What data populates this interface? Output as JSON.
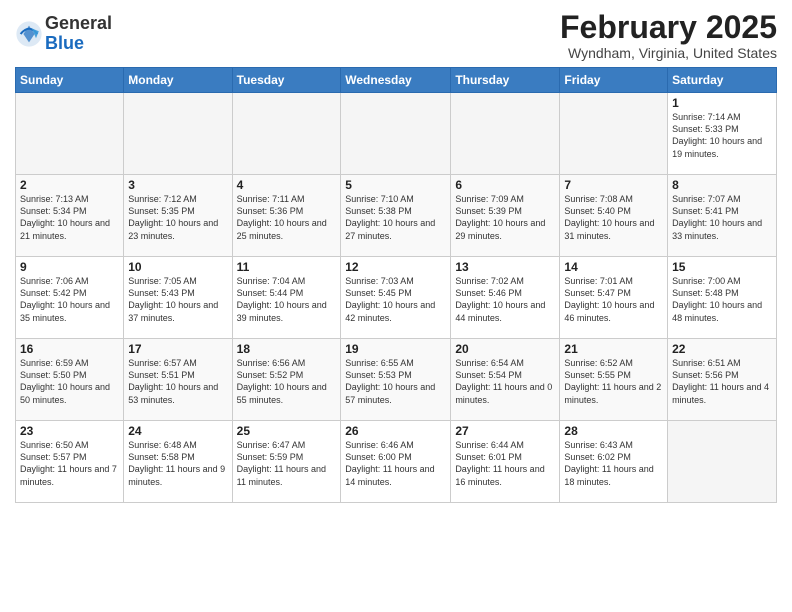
{
  "header": {
    "logo_general": "General",
    "logo_blue": "Blue",
    "title": "February 2025",
    "location": "Wyndham, Virginia, United States"
  },
  "days_of_week": [
    "Sunday",
    "Monday",
    "Tuesday",
    "Wednesday",
    "Thursday",
    "Friday",
    "Saturday"
  ],
  "weeks": [
    [
      {
        "day": "",
        "empty": true
      },
      {
        "day": "",
        "empty": true
      },
      {
        "day": "",
        "empty": true
      },
      {
        "day": "",
        "empty": true
      },
      {
        "day": "",
        "empty": true
      },
      {
        "day": "",
        "empty": true
      },
      {
        "day": "1",
        "sunrise": "7:14 AM",
        "sunset": "5:33 PM",
        "daylight": "10 hours and 19 minutes."
      }
    ],
    [
      {
        "day": "2",
        "sunrise": "7:13 AM",
        "sunset": "5:34 PM",
        "daylight": "10 hours and 21 minutes."
      },
      {
        "day": "3",
        "sunrise": "7:12 AM",
        "sunset": "5:35 PM",
        "daylight": "10 hours and 23 minutes."
      },
      {
        "day": "4",
        "sunrise": "7:11 AM",
        "sunset": "5:36 PM",
        "daylight": "10 hours and 25 minutes."
      },
      {
        "day": "5",
        "sunrise": "7:10 AM",
        "sunset": "5:38 PM",
        "daylight": "10 hours and 27 minutes."
      },
      {
        "day": "6",
        "sunrise": "7:09 AM",
        "sunset": "5:39 PM",
        "daylight": "10 hours and 29 minutes."
      },
      {
        "day": "7",
        "sunrise": "7:08 AM",
        "sunset": "5:40 PM",
        "daylight": "10 hours and 31 minutes."
      },
      {
        "day": "8",
        "sunrise": "7:07 AM",
        "sunset": "5:41 PM",
        "daylight": "10 hours and 33 minutes."
      }
    ],
    [
      {
        "day": "9",
        "sunrise": "7:06 AM",
        "sunset": "5:42 PM",
        "daylight": "10 hours and 35 minutes."
      },
      {
        "day": "10",
        "sunrise": "7:05 AM",
        "sunset": "5:43 PM",
        "daylight": "10 hours and 37 minutes."
      },
      {
        "day": "11",
        "sunrise": "7:04 AM",
        "sunset": "5:44 PM",
        "daylight": "10 hours and 39 minutes."
      },
      {
        "day": "12",
        "sunrise": "7:03 AM",
        "sunset": "5:45 PM",
        "daylight": "10 hours and 42 minutes."
      },
      {
        "day": "13",
        "sunrise": "7:02 AM",
        "sunset": "5:46 PM",
        "daylight": "10 hours and 44 minutes."
      },
      {
        "day": "14",
        "sunrise": "7:01 AM",
        "sunset": "5:47 PM",
        "daylight": "10 hours and 46 minutes."
      },
      {
        "day": "15",
        "sunrise": "7:00 AM",
        "sunset": "5:48 PM",
        "daylight": "10 hours and 48 minutes."
      }
    ],
    [
      {
        "day": "16",
        "sunrise": "6:59 AM",
        "sunset": "5:50 PM",
        "daylight": "10 hours and 50 minutes."
      },
      {
        "day": "17",
        "sunrise": "6:57 AM",
        "sunset": "5:51 PM",
        "daylight": "10 hours and 53 minutes."
      },
      {
        "day": "18",
        "sunrise": "6:56 AM",
        "sunset": "5:52 PM",
        "daylight": "10 hours and 55 minutes."
      },
      {
        "day": "19",
        "sunrise": "6:55 AM",
        "sunset": "5:53 PM",
        "daylight": "10 hours and 57 minutes."
      },
      {
        "day": "20",
        "sunrise": "6:54 AM",
        "sunset": "5:54 PM",
        "daylight": "11 hours and 0 minutes."
      },
      {
        "day": "21",
        "sunrise": "6:52 AM",
        "sunset": "5:55 PM",
        "daylight": "11 hours and 2 minutes."
      },
      {
        "day": "22",
        "sunrise": "6:51 AM",
        "sunset": "5:56 PM",
        "daylight": "11 hours and 4 minutes."
      }
    ],
    [
      {
        "day": "23",
        "sunrise": "6:50 AM",
        "sunset": "5:57 PM",
        "daylight": "11 hours and 7 minutes."
      },
      {
        "day": "24",
        "sunrise": "6:48 AM",
        "sunset": "5:58 PM",
        "daylight": "11 hours and 9 minutes."
      },
      {
        "day": "25",
        "sunrise": "6:47 AM",
        "sunset": "5:59 PM",
        "daylight": "11 hours and 11 minutes."
      },
      {
        "day": "26",
        "sunrise": "6:46 AM",
        "sunset": "6:00 PM",
        "daylight": "11 hours and 14 minutes."
      },
      {
        "day": "27",
        "sunrise": "6:44 AM",
        "sunset": "6:01 PM",
        "daylight": "11 hours and 16 minutes."
      },
      {
        "day": "28",
        "sunrise": "6:43 AM",
        "sunset": "6:02 PM",
        "daylight": "11 hours and 18 minutes."
      },
      {
        "day": "",
        "empty": true
      }
    ]
  ]
}
